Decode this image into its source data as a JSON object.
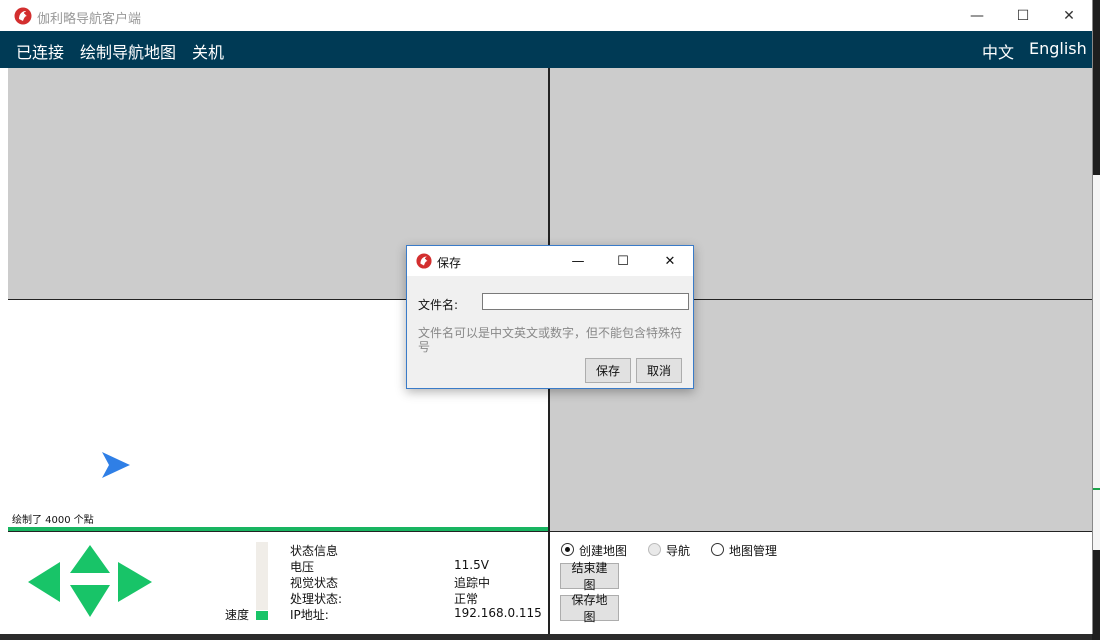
{
  "app": {
    "title": "伽利略导航客户端"
  },
  "window_controls": {
    "minimize": "—",
    "maximize": "☐",
    "close": "✕"
  },
  "menu": {
    "connected": "已连接",
    "draw_map": "绘制导航地图",
    "shutdown": "关机",
    "lang_zh": "中文",
    "lang_en": "English"
  },
  "canvas": {
    "points_text": "绘制了 4000 个點",
    "progress": 1.0
  },
  "speed": {
    "label": "速度",
    "level": 0.12
  },
  "status": {
    "heading": "状态信息",
    "rows": [
      {
        "label": "电压",
        "value": "11.5V"
      },
      {
        "label": "视觉状态",
        "value": "追踪中"
      },
      {
        "label": "处理状态:",
        "value": "正常"
      },
      {
        "label": "IP地址:",
        "value": "192.168.0.115"
      }
    ]
  },
  "mode": {
    "options": [
      {
        "label": "创建地图",
        "checked": true,
        "disabled": false
      },
      {
        "label": "导航",
        "checked": false,
        "disabled": true
      },
      {
        "label": "地图管理",
        "checked": false,
        "disabled": false
      }
    ],
    "end_build_button": "结束建图",
    "save_map_button": "保存地图"
  },
  "dialog": {
    "title": "保存",
    "filename_label": "文件名:",
    "filename_value": "",
    "hint": "文件名可以是中文英文或数字，但不能包含特殊符号",
    "save_button": "保存",
    "cancel_button": "取消"
  },
  "colors": {
    "menubar": "#003a55",
    "accent_green": "#18c468",
    "arrow_blue": "#2f7fe6",
    "panel_gray": "#cccccc"
  },
  "icons": {
    "app_logo": "red-bird-logo",
    "robot": "blue-arrow-pointer",
    "dpad": "green-triangle-arrows"
  }
}
